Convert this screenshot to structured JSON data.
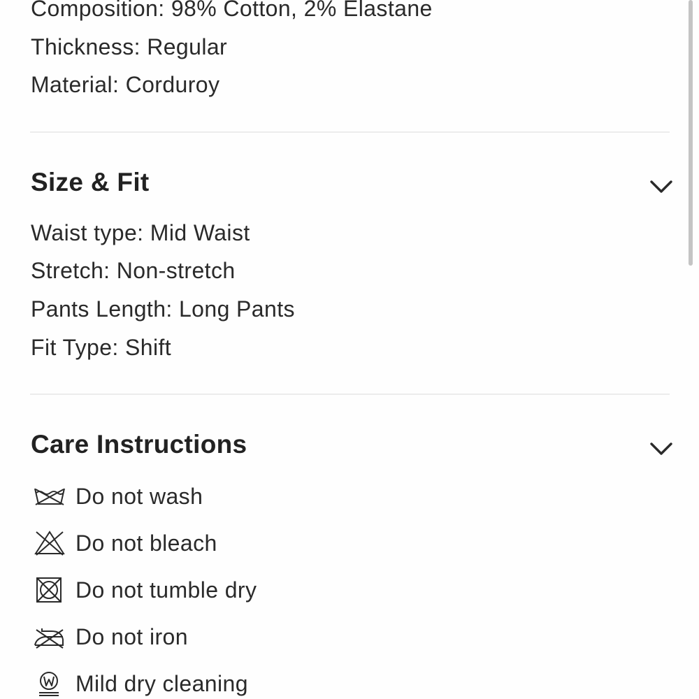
{
  "composition": {
    "lines": [
      "Composition: 98% Cotton, 2% Elastane",
      "Thickness: Regular",
      "Material: Corduroy"
    ]
  },
  "size_fit": {
    "title": "Size & Fit",
    "toggle_icon": "chevron-down-icon",
    "lines": [
      "Waist type: Mid Waist",
      "Stretch: Non-stretch",
      "Pants Length: Long Pants",
      "Fit Type: Shift"
    ]
  },
  "care": {
    "title": "Care Instructions",
    "toggle_icon": "chevron-down-icon",
    "items": [
      {
        "icon": "do-not-wash-icon",
        "label": "Do not wash"
      },
      {
        "icon": "do-not-bleach-icon",
        "label": "Do not bleach"
      },
      {
        "icon": "do-not-tumble-dry-icon",
        "label": "Do not tumble dry"
      },
      {
        "icon": "do-not-iron-icon",
        "label": "Do not iron"
      },
      {
        "icon": "mild-dry-cleaning-icon",
        "label": "Mild dry cleaning"
      }
    ]
  },
  "colors": {
    "text": "#2a2a2a",
    "divider": "#ececec",
    "scrollbar": "#c4c4c4"
  }
}
